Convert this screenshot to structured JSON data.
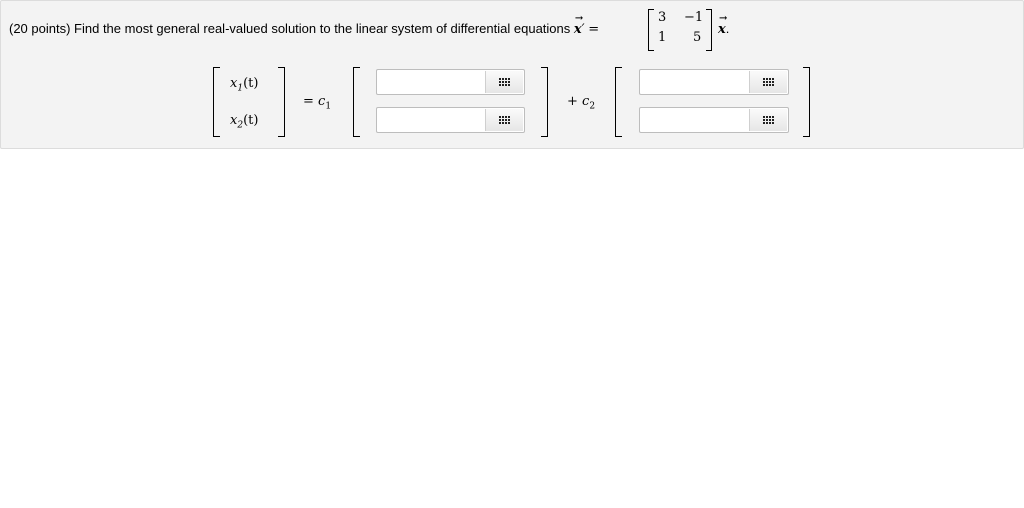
{
  "problem": {
    "points_label": "(20 points)",
    "text": "Find the most general real-valued solution to the linear system of differential equations",
    "vector_symbol": "x",
    "prime": "′",
    "equals": "=",
    "trailing": "."
  },
  "coefficient_matrix": {
    "a11": "3",
    "a12": "−1",
    "a21": "1",
    "a22": "5"
  },
  "answer": {
    "lhs": [
      "x",
      "x"
    ],
    "lhs_subscripts": [
      "1",
      "2"
    ],
    "lhs_args": [
      "(t)",
      "(t)"
    ],
    "c1_prefix": "=",
    "c1_symbol": "c",
    "c1_sub": "1",
    "c2_prefix": "+",
    "c2_symbol": "c",
    "c2_sub": "2",
    "fields": [
      {
        "value": "",
        "placeholder": ""
      },
      {
        "value": "",
        "placeholder": ""
      },
      {
        "value": "",
        "placeholder": ""
      },
      {
        "value": "",
        "placeholder": ""
      }
    ],
    "matrix_button_icon": "matrix-grid-icon"
  }
}
